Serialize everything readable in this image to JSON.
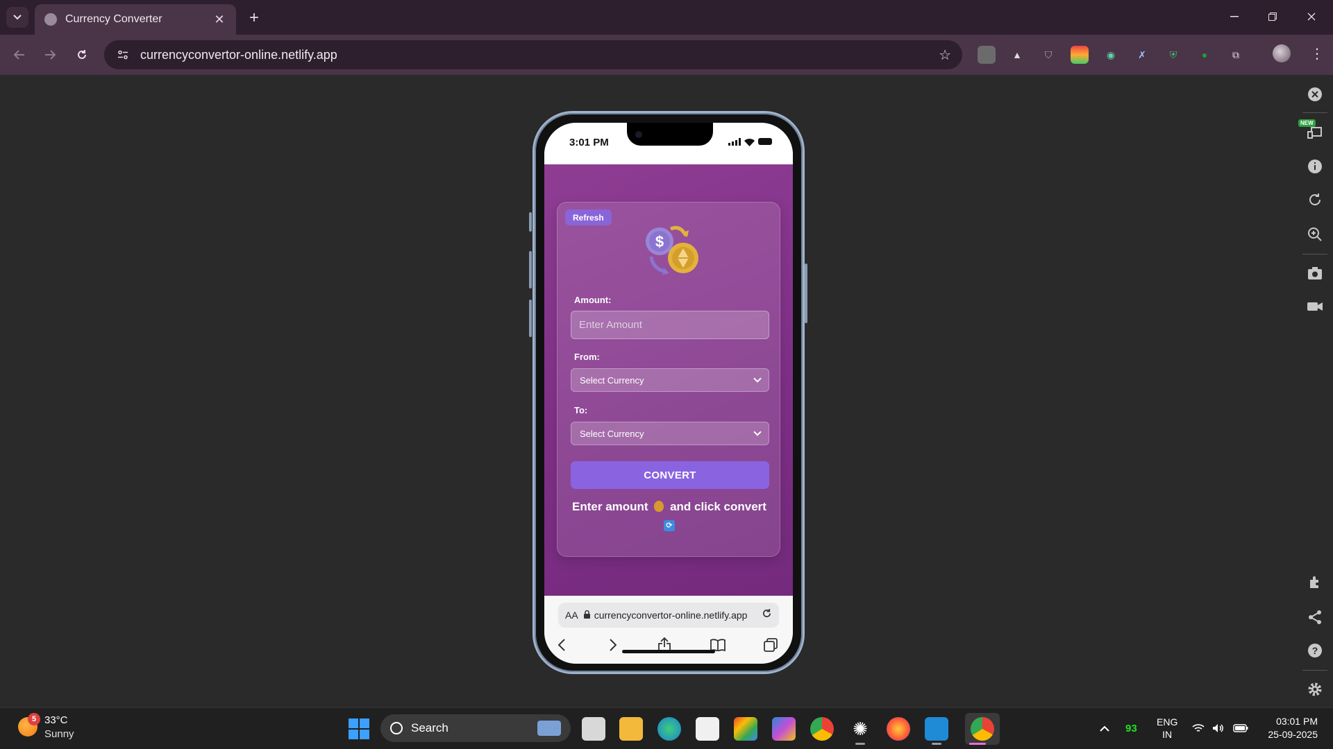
{
  "browser": {
    "tab_title": "Currency Converter",
    "url": "currencyconvertor-online.netlify.app",
    "new_tab_symbol": "+",
    "close_symbol": "✕"
  },
  "side_panel": {
    "new_badge": "NEW",
    "icons": [
      "close-icon",
      "devices-icon",
      "info-icon",
      "rotate-icon",
      "zoom-icon",
      "screenshot-icon",
      "record-icon",
      "extensions-icon",
      "share-icon",
      "help-icon",
      "settings-icon"
    ]
  },
  "phone": {
    "status_time": "3:01 PM",
    "app": {
      "refresh_label": "Refresh",
      "amount_label": "Amount:",
      "amount_placeholder": "Enter Amount",
      "from_label": "From:",
      "from_value": "Select Currency",
      "to_label": "To:",
      "to_value": "Select Currency",
      "convert_label": "CONVERT",
      "result_part1": "Enter amount",
      "result_part2": "and click convert"
    },
    "safari": {
      "aa_label": "AA",
      "url": "currencyconvertor-online.netlify.app"
    }
  },
  "taskbar": {
    "weather_temp": "33°C",
    "weather_condition": "Sunny",
    "weather_badge": "5",
    "search_label": "Search",
    "tray_battery": "93",
    "tray_lang_1": "ENG",
    "tray_lang_2": "IN",
    "clock_time": "03:01 PM",
    "clock_date": "25-09-2025"
  },
  "colors": {
    "app_gradient_start": "#8e3d93",
    "app_gradient_end": "#742a7d",
    "accent_button": "#8a64e0",
    "browser_frame": "#4a3448"
  }
}
